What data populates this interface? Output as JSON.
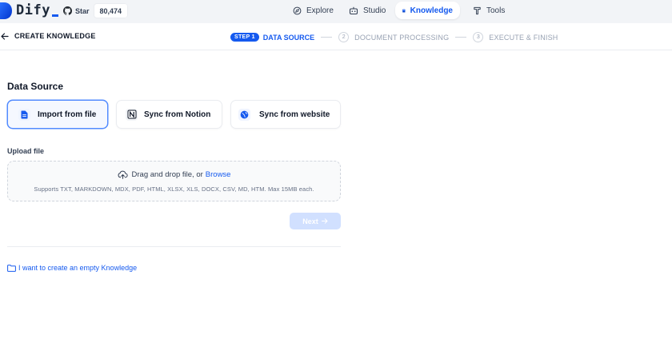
{
  "app": {
    "name": "Dify",
    "github": {
      "star_label": "Star",
      "star_count": "80,474"
    }
  },
  "nav": {
    "items": [
      {
        "label": "Explore",
        "icon": "compass-icon"
      },
      {
        "label": "Studio",
        "icon": "robot-icon"
      },
      {
        "label": "Knowledge",
        "icon": "book-icon",
        "active": true
      },
      {
        "label": "Tools",
        "icon": "hammer-icon"
      }
    ]
  },
  "header": {
    "back_label": "CREATE KNOWLEDGE",
    "steps": [
      {
        "badge": "STEP 1",
        "label": "DATA SOURCE",
        "active": true
      },
      {
        "badge": "2",
        "label": "DOCUMENT PROCESSING"
      },
      {
        "badge": "3",
        "label": "EXECUTE & FINISH"
      }
    ]
  },
  "data_source": {
    "title": "Data Source",
    "options": [
      {
        "label": "Import from file",
        "icon": "file-icon",
        "selected": true
      },
      {
        "label": "Sync from Notion",
        "icon": "notion-icon"
      },
      {
        "label": "Sync from website",
        "icon": "globe-icon"
      }
    ]
  },
  "upload": {
    "label": "Upload file",
    "drop_text": "Drag and drop file, or",
    "browse_label": "Browse",
    "support_text": "Supports TXT, MARKDOWN, MDX, PDF, HTML, XLSX, XLS, DOCX, CSV, MD, HTM. Max 15MB each."
  },
  "actions": {
    "next_label": "Next",
    "empty_knowledge_label": "I want to create an empty Knowledge"
  },
  "colors": {
    "accent": "#155aef",
    "nav_bg": "#f2f4f7",
    "next_disabled": "#d1e0ff"
  }
}
